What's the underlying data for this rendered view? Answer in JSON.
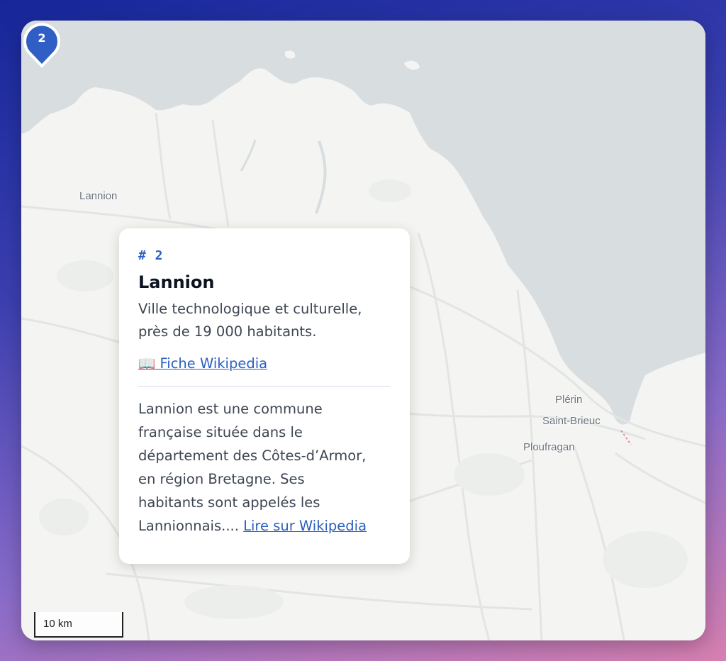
{
  "map": {
    "labels": {
      "lannion": "Lannion",
      "plerin": "Plérin",
      "saint_brieuc": "Saint-Brieuc",
      "ploufragan": "Ploufragan"
    },
    "scale": "10 km",
    "colors": {
      "sea": "#d8dde0",
      "land": "#f4f5f2",
      "roads": "#e3e6e4",
      "marker": "#2f5fc4"
    }
  },
  "marker": {
    "number": "2",
    "icon": "map-pin-icon"
  },
  "popup": {
    "number": "# 2",
    "title": "Lannion",
    "description_line1": "Ville technologique et culturelle,",
    "description_line2": "près de 19 000 habitants.",
    "wiki_icon": "📖",
    "wiki_label": "Fiche Wikipedia",
    "extract_line1": "Lannion est une commune",
    "extract_line2": "française située dans le",
    "extract_line3": "département des Côtes-d’Armor,",
    "extract_line4": "en région Bretagne. Ses",
    "extract_line5": "habitants sont appelés les",
    "extract_line6": "Lannionnais....",
    "read_more_label": "Lire sur Wikipedia"
  }
}
